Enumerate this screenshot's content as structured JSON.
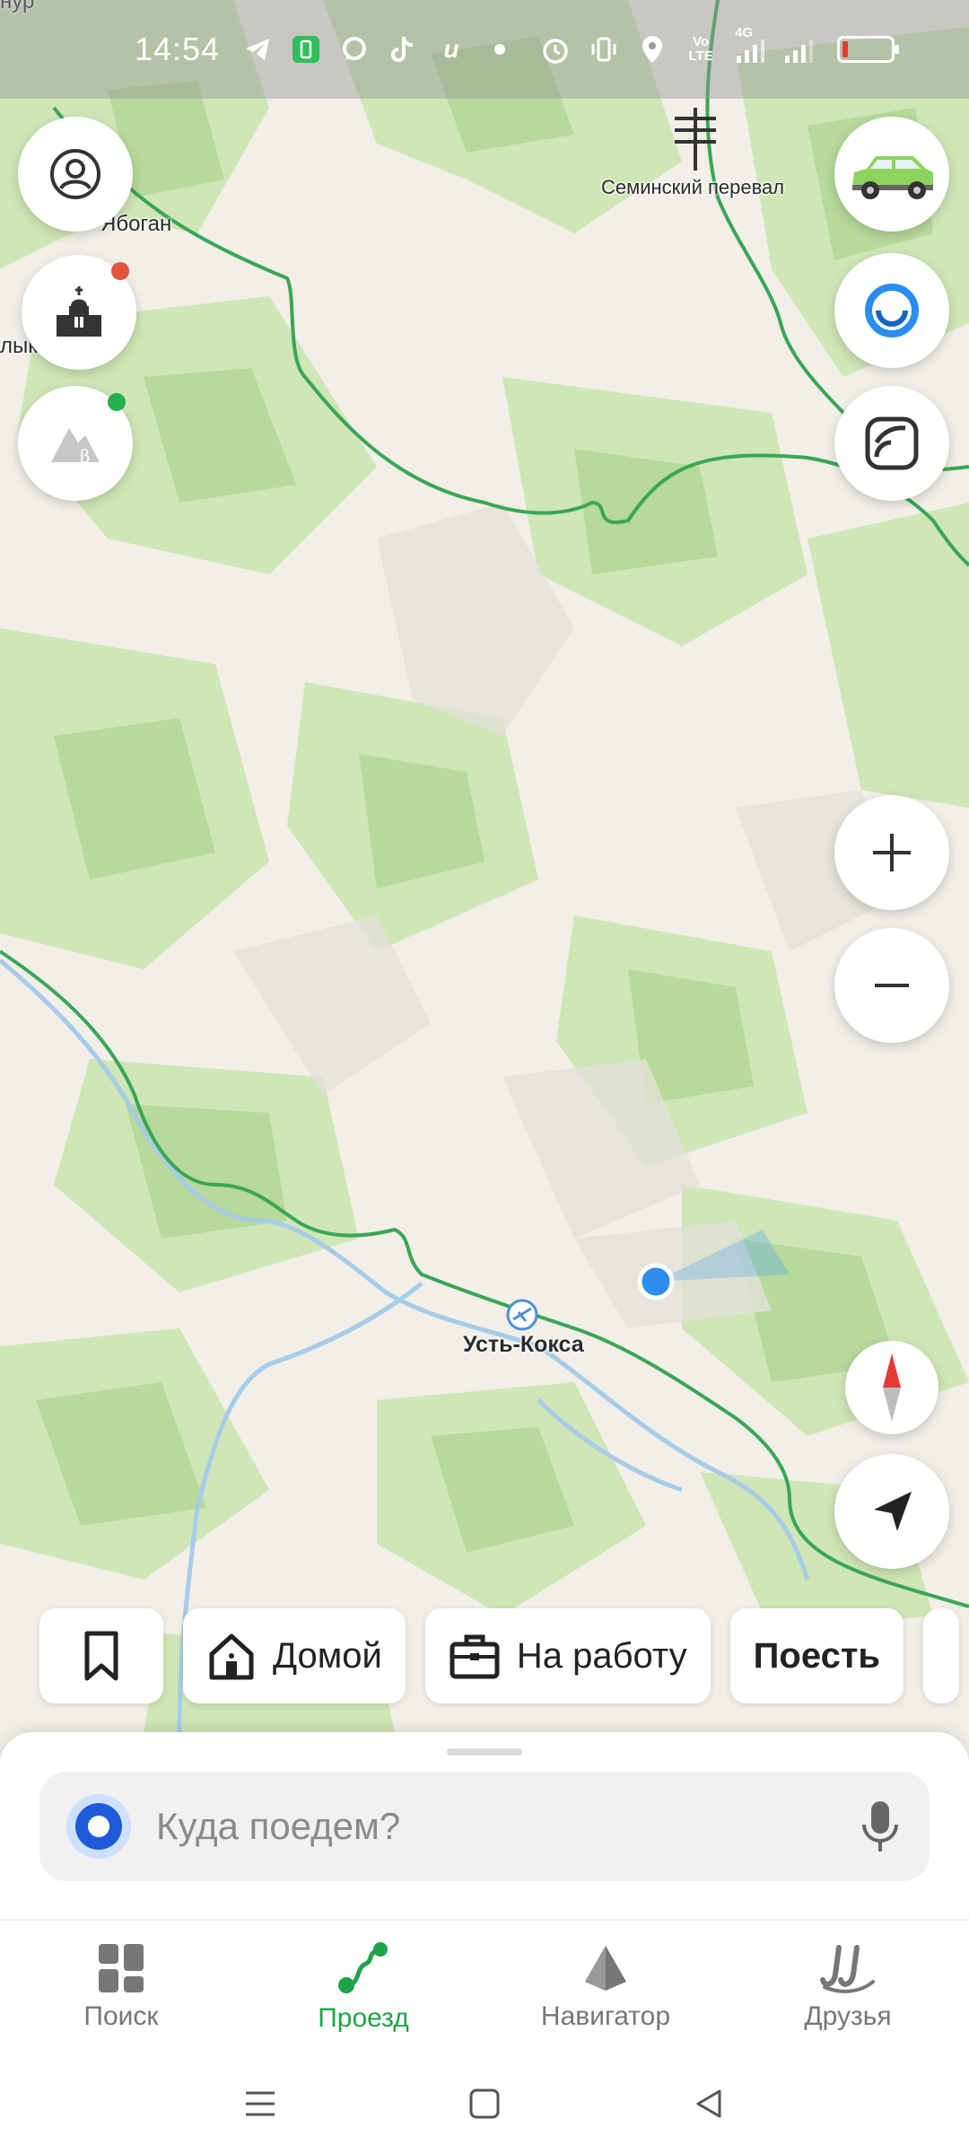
{
  "status_bar": {
    "time": "14:54",
    "volte": "Vo LTE",
    "network": "4G",
    "battery_level": 0.1,
    "icons": [
      "telegram-icon",
      "battery-saver-icon",
      "chat-icon",
      "tiktok-icon",
      "i-icon",
      "dot-icon",
      "alarm-icon",
      "vibrate-icon",
      "location-icon",
      "signal-icon",
      "signal-icon"
    ]
  },
  "map": {
    "labels": {
      "top_left": "нур",
      "yabogan": "Ябоган",
      "left_edge": "лык",
      "seminsky_pass": "Семинский перевал",
      "ust_koksa": "Усть-Кокса"
    },
    "colors": {
      "background": "#f1efe8",
      "forest": "#c9e3b0",
      "forest_dark": "#b5d698",
      "road": "#3aa655",
      "river": "#a6cce8",
      "location": "#2e8ef0"
    }
  },
  "left_controls": [
    {
      "name": "profile-button",
      "icon": "user-icon"
    },
    {
      "name": "places-layer-button",
      "icon": "landmark-icon",
      "badge_color": "#e0533d"
    },
    {
      "name": "terrain-beta-button",
      "icon": "mountain-beta-icon",
      "badge_color": "#22b14c"
    }
  ],
  "right_controls": [
    {
      "name": "car-button",
      "icon": "car-icon"
    },
    {
      "name": "assistant-button",
      "icon": "alice-icon"
    },
    {
      "name": "layers-button",
      "icon": "stack-icon"
    }
  ],
  "chips": {
    "bookmarks_icon": "bookmark-icon",
    "home": "Домой",
    "work": "На работу",
    "eat": "Поесть"
  },
  "search": {
    "placeholder": "Куда поедем?"
  },
  "tabs": [
    {
      "label": "Поиск",
      "icon": "grid-icon"
    },
    {
      "label": "Проезд",
      "icon": "route-icon",
      "active": true
    },
    {
      "label": "Навигатор",
      "icon": "navigator-icon"
    },
    {
      "label": "Друзья",
      "icon": "friends-icon"
    }
  ]
}
